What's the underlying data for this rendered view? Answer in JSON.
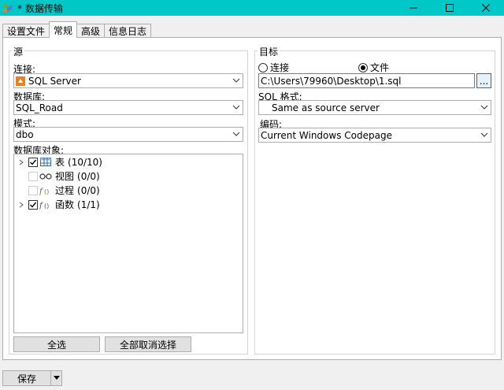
{
  "window": {
    "title": "* 数据传输"
  },
  "tabs": [
    {
      "label": "设置文件",
      "active": false
    },
    {
      "label": "常规",
      "active": true
    },
    {
      "label": "高级",
      "active": false
    },
    {
      "label": "信息日志",
      "active": false
    }
  ],
  "source": {
    "group_title": "源",
    "connection_label": "连接:",
    "connection_value": "SQL Server",
    "database_label": "数据库:",
    "database_value": "SQL_Road",
    "schema_label": "模式:",
    "schema_value": "dbo",
    "objects_label": "数据库对象:",
    "tree": [
      {
        "label": "表",
        "count": "(10/10)",
        "checked": true,
        "expandable": true,
        "icon": "table-icon"
      },
      {
        "label": "视图",
        "count": "(0/0)",
        "checked": false,
        "expandable": false,
        "icon": "view-icon"
      },
      {
        "label": "过程",
        "count": "(0/0)",
        "checked": false,
        "expandable": false,
        "icon": "procedure-icon"
      },
      {
        "label": "函数",
        "count": "(1/1)",
        "checked": true,
        "expandable": true,
        "icon": "function-icon"
      }
    ],
    "select_all_label": "全选",
    "deselect_all_label": "全部取消选择"
  },
  "target": {
    "group_title": "目标",
    "radio_connection_label": "连接",
    "radio_file_label": "文件",
    "selected_mode": "file",
    "file_path": "C:\\Users\\79960\\Desktop\\1.sql",
    "browse_label": "...",
    "sql_format_label": "SQL 格式:",
    "sql_format_value": "Same as source server",
    "encoding_label": "编码:",
    "encoding_value": "Current Windows Codepage"
  },
  "footer": {
    "save_label": "保存"
  }
}
